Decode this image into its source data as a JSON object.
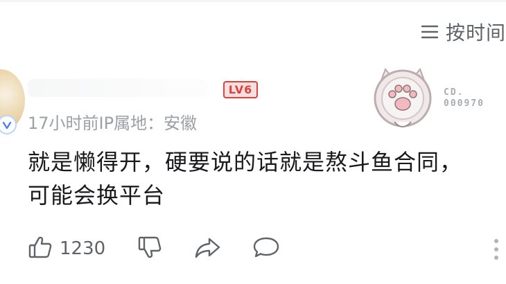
{
  "header": {
    "sort_label": "按时间",
    "sort_icon": "list-icon"
  },
  "comment": {
    "level_badge": "LV6",
    "time": "17小时前",
    "ip_location": "IP属地：安徽",
    "content_lines": [
      "就是懒得开，硬要说的话就是熬斗鱼合同，",
      "可能会换平台"
    ],
    "decoration_text": [
      "CD.",
      "000970"
    ],
    "likes": "1230"
  },
  "icons": {
    "like": "thumb-up-icon",
    "dislike": "thumb-down-icon",
    "share": "share-icon",
    "reply": "reply-bubble-icon",
    "more": "more-vertical-icon",
    "decoration": "cat-paw-badge-icon"
  },
  "colors": {
    "level_red": "#d9443b",
    "text": "#18191c",
    "meta_gray": "#9aa0a6",
    "icon_gray": "#5f6368"
  }
}
